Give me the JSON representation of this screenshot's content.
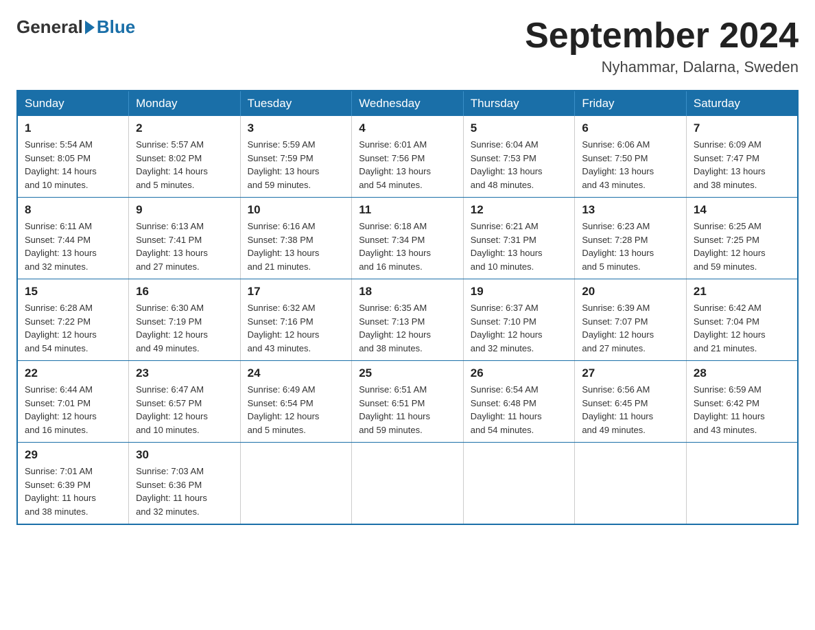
{
  "header": {
    "logo_general": "General",
    "logo_blue": "Blue",
    "month_title": "September 2024",
    "location": "Nyhammar, Dalarna, Sweden"
  },
  "days_of_week": [
    "Sunday",
    "Monday",
    "Tuesday",
    "Wednesday",
    "Thursday",
    "Friday",
    "Saturday"
  ],
  "weeks": [
    [
      {
        "day": "1",
        "sunrise": "5:54 AM",
        "sunset": "8:05 PM",
        "daylight": "14 hours and 10 minutes."
      },
      {
        "day": "2",
        "sunrise": "5:57 AM",
        "sunset": "8:02 PM",
        "daylight": "14 hours and 5 minutes."
      },
      {
        "day": "3",
        "sunrise": "5:59 AM",
        "sunset": "7:59 PM",
        "daylight": "13 hours and 59 minutes."
      },
      {
        "day": "4",
        "sunrise": "6:01 AM",
        "sunset": "7:56 PM",
        "daylight": "13 hours and 54 minutes."
      },
      {
        "day": "5",
        "sunrise": "6:04 AM",
        "sunset": "7:53 PM",
        "daylight": "13 hours and 48 minutes."
      },
      {
        "day": "6",
        "sunrise": "6:06 AM",
        "sunset": "7:50 PM",
        "daylight": "13 hours and 43 minutes."
      },
      {
        "day": "7",
        "sunrise": "6:09 AM",
        "sunset": "7:47 PM",
        "daylight": "13 hours and 38 minutes."
      }
    ],
    [
      {
        "day": "8",
        "sunrise": "6:11 AM",
        "sunset": "7:44 PM",
        "daylight": "13 hours and 32 minutes."
      },
      {
        "day": "9",
        "sunrise": "6:13 AM",
        "sunset": "7:41 PM",
        "daylight": "13 hours and 27 minutes."
      },
      {
        "day": "10",
        "sunrise": "6:16 AM",
        "sunset": "7:38 PM",
        "daylight": "13 hours and 21 minutes."
      },
      {
        "day": "11",
        "sunrise": "6:18 AM",
        "sunset": "7:34 PM",
        "daylight": "13 hours and 16 minutes."
      },
      {
        "day": "12",
        "sunrise": "6:21 AM",
        "sunset": "7:31 PM",
        "daylight": "13 hours and 10 minutes."
      },
      {
        "day": "13",
        "sunrise": "6:23 AM",
        "sunset": "7:28 PM",
        "daylight": "13 hours and 5 minutes."
      },
      {
        "day": "14",
        "sunrise": "6:25 AM",
        "sunset": "7:25 PM",
        "daylight": "12 hours and 59 minutes."
      }
    ],
    [
      {
        "day": "15",
        "sunrise": "6:28 AM",
        "sunset": "7:22 PM",
        "daylight": "12 hours and 54 minutes."
      },
      {
        "day": "16",
        "sunrise": "6:30 AM",
        "sunset": "7:19 PM",
        "daylight": "12 hours and 49 minutes."
      },
      {
        "day": "17",
        "sunrise": "6:32 AM",
        "sunset": "7:16 PM",
        "daylight": "12 hours and 43 minutes."
      },
      {
        "day": "18",
        "sunrise": "6:35 AM",
        "sunset": "7:13 PM",
        "daylight": "12 hours and 38 minutes."
      },
      {
        "day": "19",
        "sunrise": "6:37 AM",
        "sunset": "7:10 PM",
        "daylight": "12 hours and 32 minutes."
      },
      {
        "day": "20",
        "sunrise": "6:39 AM",
        "sunset": "7:07 PM",
        "daylight": "12 hours and 27 minutes."
      },
      {
        "day": "21",
        "sunrise": "6:42 AM",
        "sunset": "7:04 PM",
        "daylight": "12 hours and 21 minutes."
      }
    ],
    [
      {
        "day": "22",
        "sunrise": "6:44 AM",
        "sunset": "7:01 PM",
        "daylight": "12 hours and 16 minutes."
      },
      {
        "day": "23",
        "sunrise": "6:47 AM",
        "sunset": "6:57 PM",
        "daylight": "12 hours and 10 minutes."
      },
      {
        "day": "24",
        "sunrise": "6:49 AM",
        "sunset": "6:54 PM",
        "daylight": "12 hours and 5 minutes."
      },
      {
        "day": "25",
        "sunrise": "6:51 AM",
        "sunset": "6:51 PM",
        "daylight": "11 hours and 59 minutes."
      },
      {
        "day": "26",
        "sunrise": "6:54 AM",
        "sunset": "6:48 PM",
        "daylight": "11 hours and 54 minutes."
      },
      {
        "day": "27",
        "sunrise": "6:56 AM",
        "sunset": "6:45 PM",
        "daylight": "11 hours and 49 minutes."
      },
      {
        "day": "28",
        "sunrise": "6:59 AM",
        "sunset": "6:42 PM",
        "daylight": "11 hours and 43 minutes."
      }
    ],
    [
      {
        "day": "29",
        "sunrise": "7:01 AM",
        "sunset": "6:39 PM",
        "daylight": "11 hours and 38 minutes."
      },
      {
        "day": "30",
        "sunrise": "7:03 AM",
        "sunset": "6:36 PM",
        "daylight": "11 hours and 32 minutes."
      },
      null,
      null,
      null,
      null,
      null
    ]
  ],
  "labels": {
    "sunrise": "Sunrise:",
    "sunset": "Sunset:",
    "daylight": "Daylight:"
  }
}
